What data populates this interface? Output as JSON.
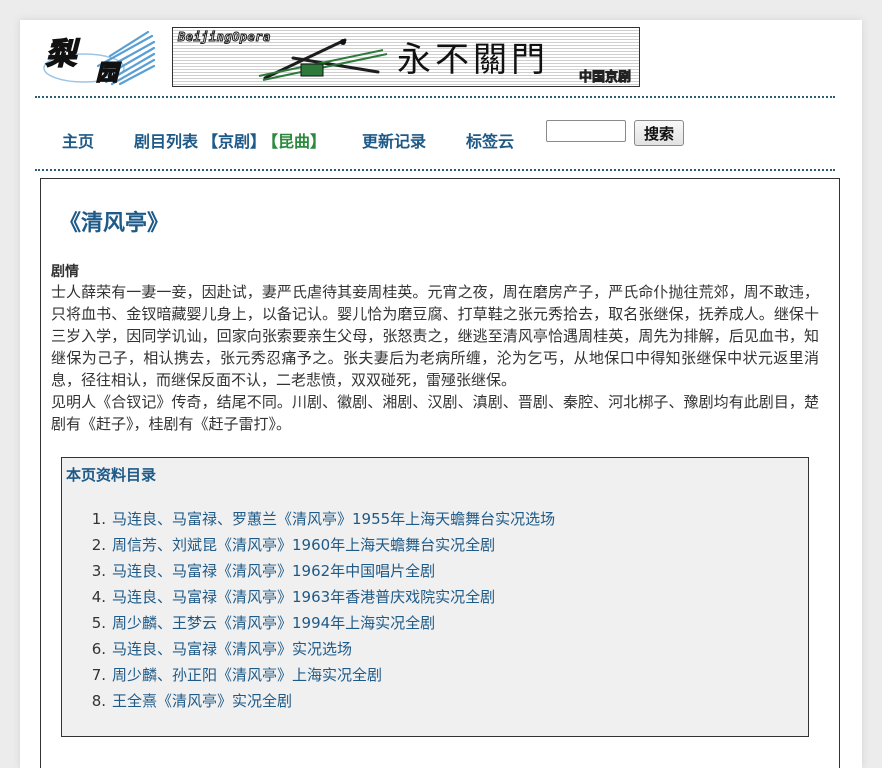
{
  "header": {
    "logo_text": "梨园",
    "banner_brand": "BeijingOpera",
    "banner_motto": "永不關門",
    "banner_sub": "中国京剧"
  },
  "nav": {
    "home": "主页",
    "repertoire": "剧目列表",
    "jingju": "【京剧】",
    "kunqu": "【昆曲】",
    "updates": "更新记录",
    "tags": "标签云",
    "search_value": "",
    "search_button": "搜索"
  },
  "page": {
    "title": "《清风亭》",
    "section_label": "剧情",
    "synopsis_1": "士人薛荣有一妻一妾，因赴试，妻严氏虐待其妾周桂英。元宵之夜，周在磨房产子，严氏命仆抛往荒郊，周不敢违，只将血书、金钗暗藏婴儿身上，以备记认。婴儿恰为磨豆腐、打草鞋之张元秀拾去，取名张继保，抚养成人。继保十三岁入学，因同学讥讪，回家向张索要亲生父母，张怒责之，继逃至清风亭恰遇周桂英，周先为排解，后见血书，知继保为己子，相认携去，张元秀忍痛予之。张夫妻后为老病所缠，沦为乞丐，从地保口中得知张继保中状元返里消息，径往相认，而继保反面不认，二老悲愤，双双碰死，雷殛张继保。",
    "synopsis_2": "见明人《合钗记》传奇，结尾不同。川剧、徽剧、湘剧、汉剧、滇剧、晋剧、秦腔、河北梆子、豫剧均有此剧目，楚剧有《赶子》，桂剧有《赶子雷打》。"
  },
  "toc": {
    "title": "本页资料目录",
    "items": [
      {
        "num": "1.",
        "label": "马连良、马富禄、罗蕙兰《清风亭》1955年上海天蟾舞台实况选场"
      },
      {
        "num": "2.",
        "label": "周信芳、刘斌昆《清风亭》1960年上海天蟾舞台实况全剧"
      },
      {
        "num": "3.",
        "label": "马连良、马富禄《清风亭》1962年中国唱片全剧"
      },
      {
        "num": "4.",
        "label": "马连良、马富禄《清风亭》1963年香港普庆戏院实况全剧"
      },
      {
        "num": "5.",
        "label": "周少麟、王梦云《清风亭》1994年上海实况全剧"
      },
      {
        "num": "6.",
        "label": "马连良、马富禄《清风亭》实况选场"
      },
      {
        "num": "7.",
        "label": "周少麟、孙正阳《清风亭》上海实况全剧"
      },
      {
        "num": "8.",
        "label": "王全熹《清风亭》实况全剧"
      }
    ]
  },
  "colors": {
    "link": "#1e5a88",
    "green_link": "#2b8a3e",
    "toc_background": "#f0f0f0"
  }
}
